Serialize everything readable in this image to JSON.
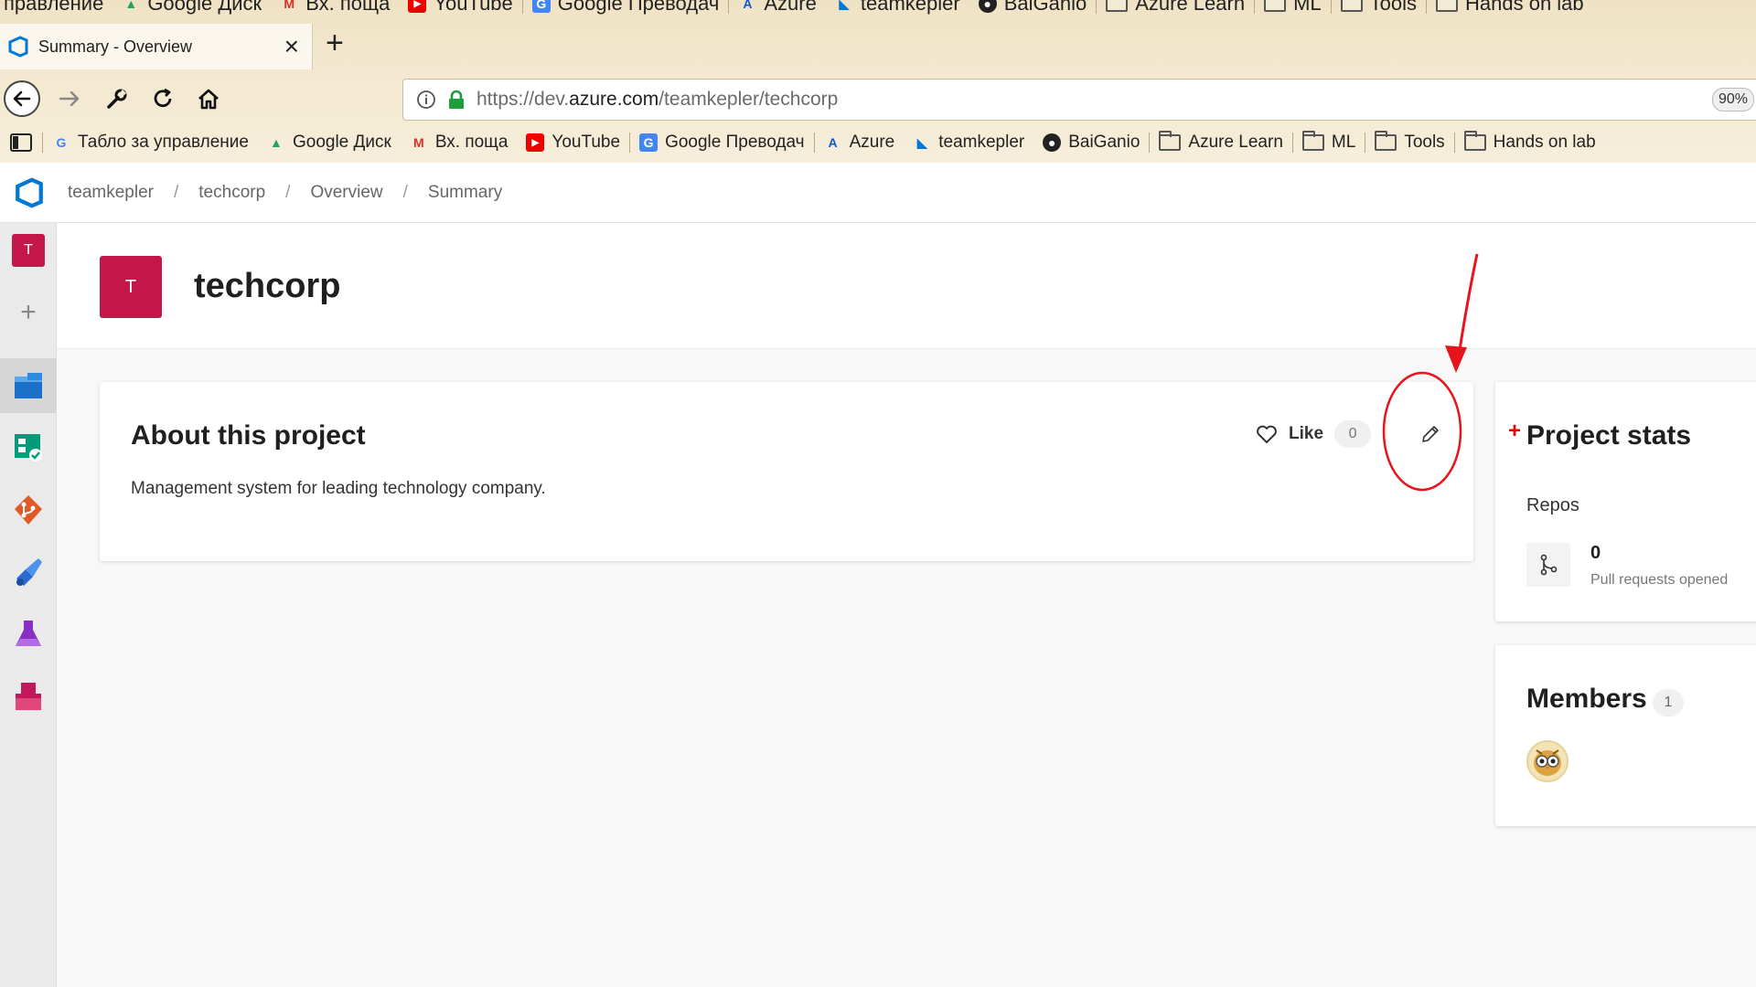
{
  "browser": {
    "top_bookmarks": [
      {
        "label": "правление",
        "icon": "none"
      },
      {
        "label": "Google Диск",
        "icon": "google-drive-icon"
      },
      {
        "label": "Вх. поща",
        "icon": "gmail-icon"
      },
      {
        "label": "YouTube",
        "icon": "youtube-icon"
      },
      {
        "label": "Google Преводач",
        "icon": "google-translate-icon"
      },
      {
        "label": "Azure",
        "icon": "azure-icon"
      },
      {
        "label": "teamkepler",
        "icon": "azure-devops-icon"
      },
      {
        "label": "BaiGanio",
        "icon": "github-icon"
      },
      {
        "label": "Azure Learn",
        "icon": "folder-icon"
      },
      {
        "label": "ML",
        "icon": "folder-icon"
      },
      {
        "label": "Tools",
        "icon": "folder-icon"
      },
      {
        "label": "Hands on lab",
        "icon": "folder-icon"
      }
    ],
    "tab": {
      "title": "Summary - Overview",
      "close": "×"
    },
    "new_tab": "+",
    "url": {
      "scheme": "https://dev.",
      "domain": "azure.com",
      "path": "/teamkepler/techcorp"
    },
    "zoom": "90%",
    "bookmarks": [
      {
        "label": "Табло за управление",
        "icon": "google-icon"
      },
      {
        "label": "Google Диск",
        "icon": "google-drive-icon"
      },
      {
        "label": "Вх. поща",
        "icon": "gmail-icon"
      },
      {
        "label": "YouTube",
        "icon": "youtube-icon"
      },
      {
        "label": "Google Преводач",
        "icon": "google-translate-icon"
      },
      {
        "label": "Azure",
        "icon": "azure-icon"
      },
      {
        "label": "teamkepler",
        "icon": "azure-devops-icon"
      },
      {
        "label": "BaiGanio",
        "icon": "github-icon"
      },
      {
        "label": "Azure Learn",
        "icon": "folder-icon"
      },
      {
        "label": "ML",
        "icon": "folder-icon"
      },
      {
        "label": "Tools",
        "icon": "folder-icon"
      },
      {
        "label": "Hands on lab",
        "icon": "folder-icon"
      }
    ]
  },
  "breadcrumb": {
    "items": [
      "teamkepler",
      "techcorp",
      "Overview",
      "Summary"
    ],
    "separator": "/"
  },
  "rail": {
    "project_initial": "T",
    "add": "+"
  },
  "project": {
    "initial": "T",
    "name": "techcorp",
    "color": "#c3174a"
  },
  "about": {
    "title": "About this project",
    "description": "Management system for leading technology company.",
    "like_label": "Like",
    "like_count": "0"
  },
  "stats": {
    "title": "Project stats",
    "section": "Repos",
    "pr_value": "0",
    "pr_label": "Pull requests opened"
  },
  "members": {
    "title": "Members",
    "count": "1"
  },
  "annotation": {
    "color": "#e8141c"
  }
}
